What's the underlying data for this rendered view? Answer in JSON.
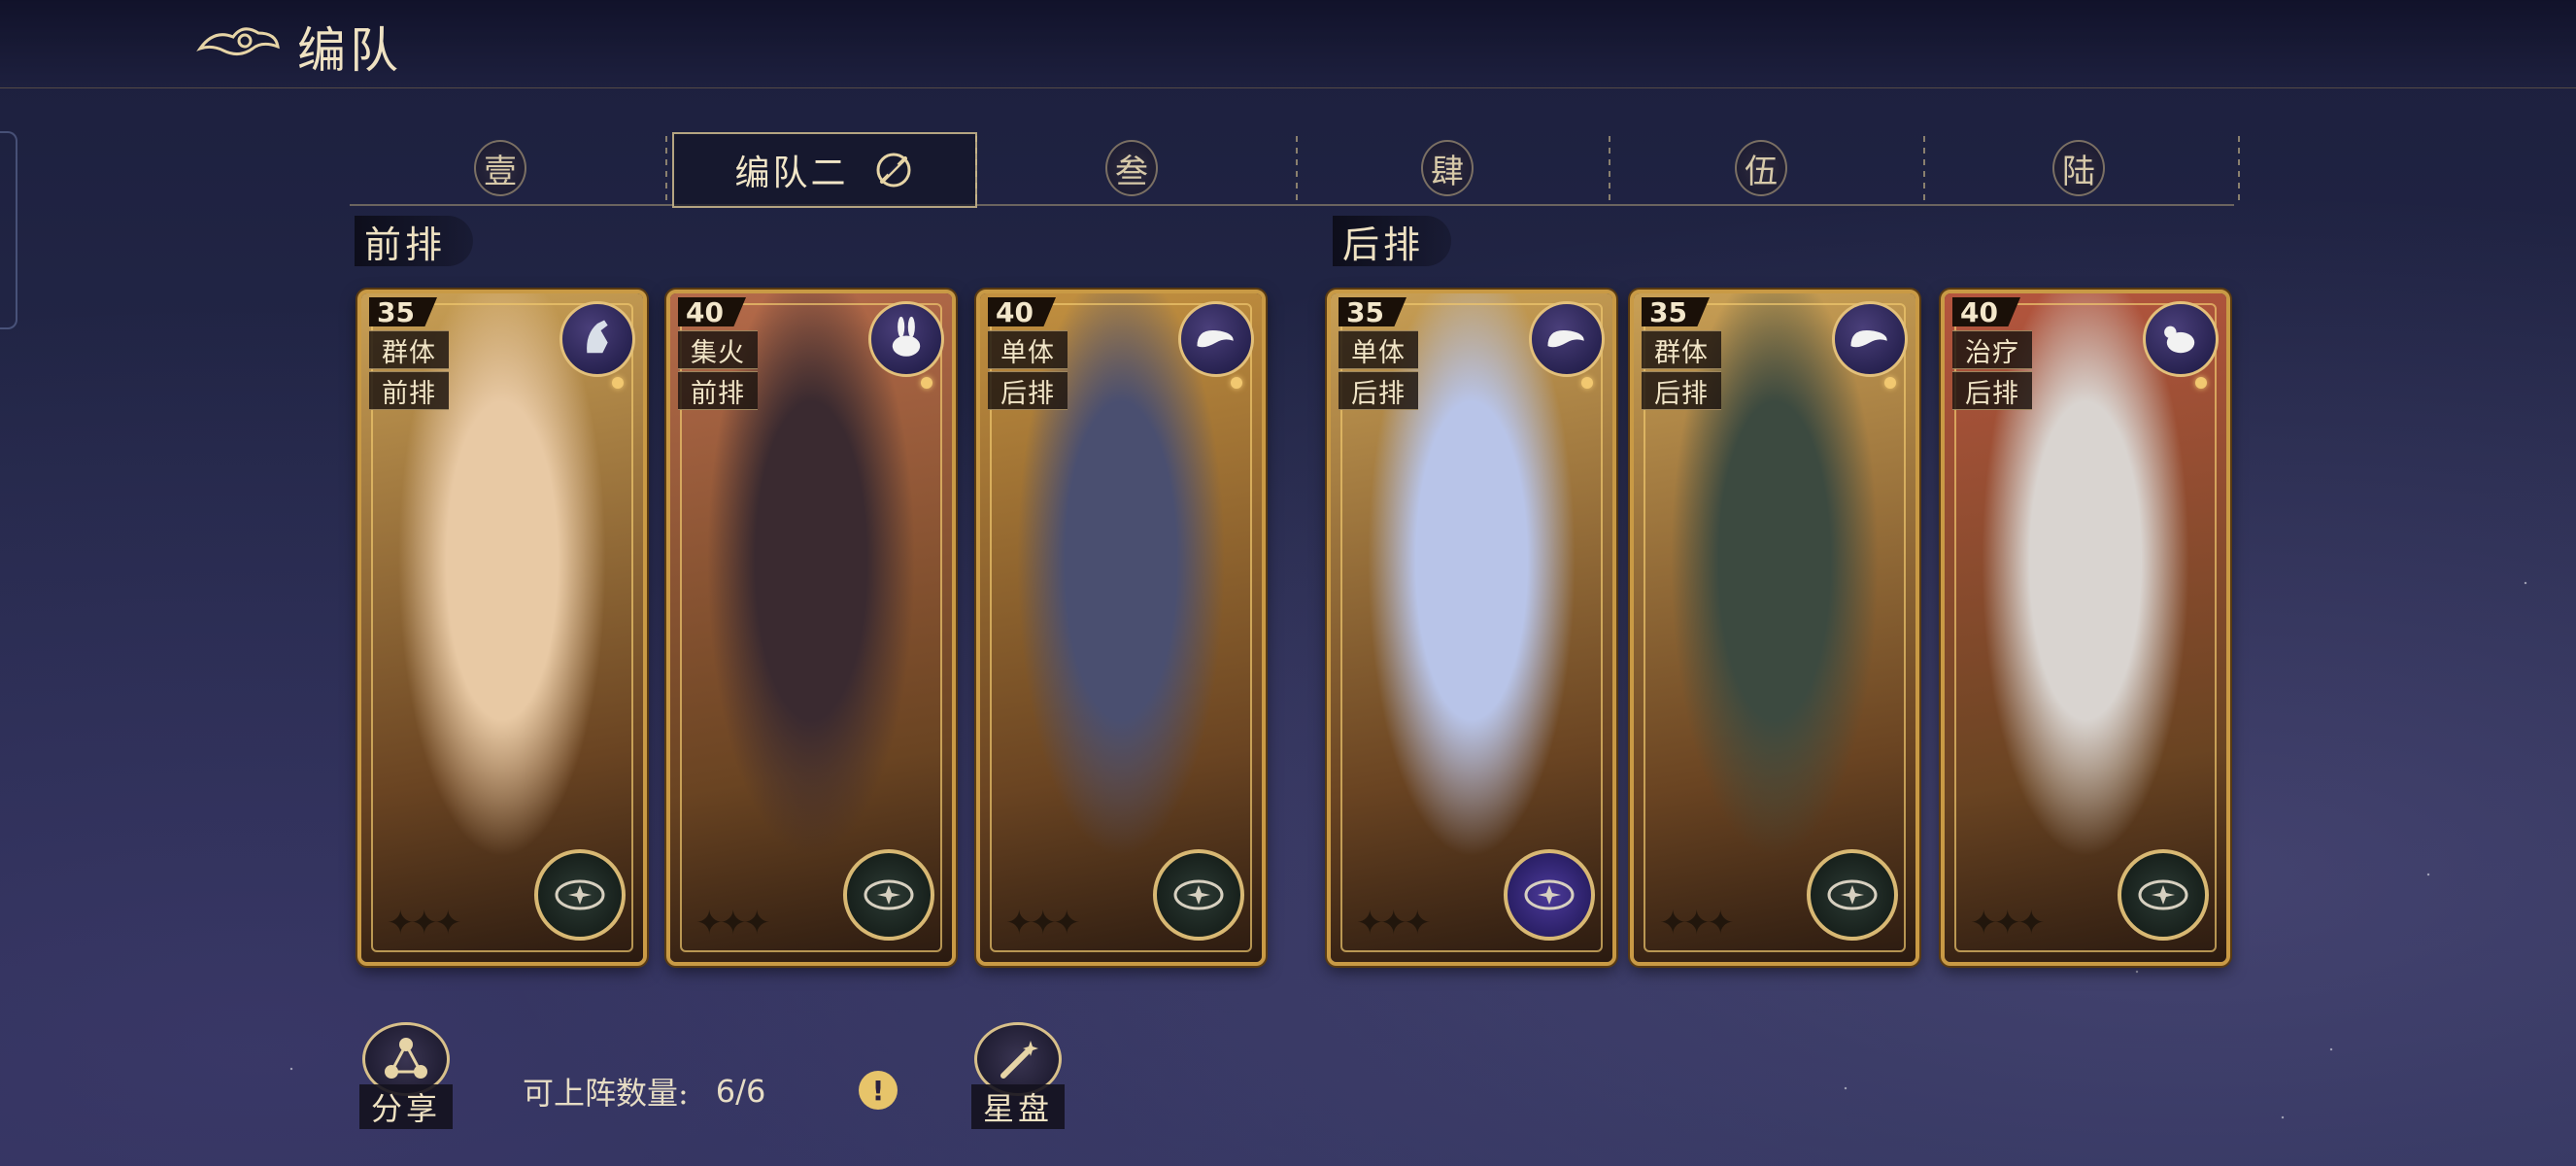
{
  "header": {
    "title": "编队"
  },
  "tabs": [
    {
      "label": "壹",
      "active": false
    },
    {
      "label": "编队二",
      "active": true
    },
    {
      "label": "叁",
      "active": false
    },
    {
      "label": "肆",
      "active": false
    },
    {
      "label": "伍",
      "active": false
    },
    {
      "label": "陆",
      "active": false
    }
  ],
  "sections": {
    "front": "前排",
    "back": "后排"
  },
  "cards": [
    {
      "level": "35",
      "tag1": "群体",
      "tag2": "前排",
      "zodiac": "horse-icon",
      "bg": "#c9a055",
      "art": "#e8c9a4",
      "astro": "normal"
    },
    {
      "level": "40",
      "tag1": "集火",
      "tag2": "前排",
      "zodiac": "rabbit-icon",
      "bg": "#b56a4a",
      "art": "#3a2a30",
      "astro": "normal"
    },
    {
      "level": "40",
      "tag1": "单体",
      "tag2": "后排",
      "zodiac": "snake-icon",
      "bg": "#c39140",
      "art": "#4a4f70",
      "astro": "normal"
    },
    {
      "level": "35",
      "tag1": "单体",
      "tag2": "后排",
      "zodiac": "snake-icon",
      "bg": "#c9a055",
      "art": "#b8c4e8",
      "astro": "purple"
    },
    {
      "level": "35",
      "tag1": "群体",
      "tag2": "后排",
      "zodiac": "snake-icon",
      "bg": "#c9a055",
      "art": "#3c4a40",
      "astro": "normal"
    },
    {
      "level": "40",
      "tag1": "治疗",
      "tag2": "后排",
      "zodiac": "sheep-icon",
      "bg": "#b5553e",
      "art": "#d9d4d0",
      "astro": "normal"
    }
  ],
  "bottom": {
    "share_label": "分享",
    "deploy_label": "可上阵数量:",
    "deploy_value": "6/6",
    "info": "!",
    "starchart_label": "星盘"
  },
  "colors": {
    "gold": "#c99a45",
    "bg": "#232748"
  }
}
